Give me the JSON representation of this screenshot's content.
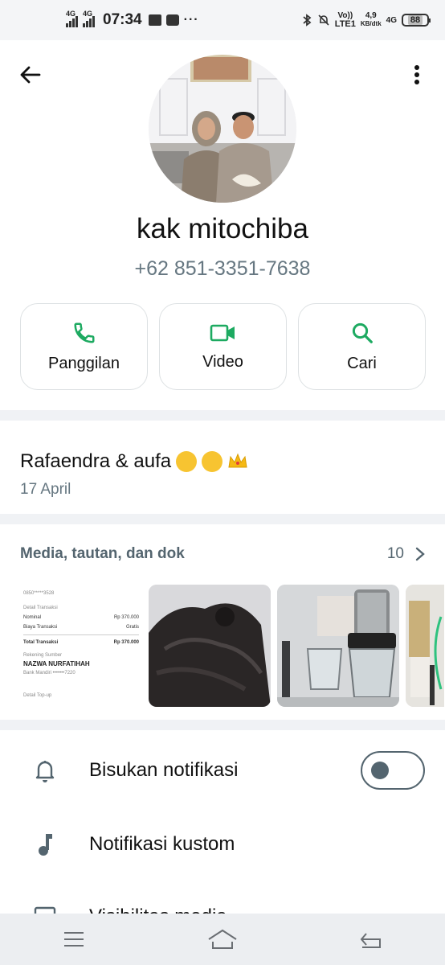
{
  "status_bar": {
    "net1": "4G",
    "net2": "4G",
    "time": "07:34",
    "dots": "···",
    "volte": "Vo))",
    "lte": "LTE1",
    "speed_value": "4,9",
    "speed_unit": "KB/dtk",
    "net3": "4G",
    "battery": "88"
  },
  "contact": {
    "name": "kak mitochiba",
    "phone": "+62 851-3351-7638"
  },
  "actions": [
    {
      "label": "Panggilan",
      "icon": "phone-icon"
    },
    {
      "label": "Video",
      "icon": "video-icon"
    },
    {
      "label": "Cari",
      "icon": "search-icon"
    }
  ],
  "about": {
    "text": "Rafaendra & aufa",
    "date": "17 April"
  },
  "media": {
    "title": "Media, tautan, dan dok",
    "count": "10",
    "receipt": {
      "number": "0850*****3528",
      "section": "Detail Transaksi",
      "nominal_label": "Nominal",
      "nominal_value": "Rp 370.000",
      "fee_label": "Biaya Transaksi",
      "fee_value": "Gratis",
      "total_label": "Total Transaksi",
      "total_value": "Rp 370.000",
      "source_label": "Rekening Sumber",
      "source_name": "NAZWA NURFATIHAH",
      "bank": "Bank Mandiri •••••••7220",
      "footer": "Detail Top-up"
    }
  },
  "settings": [
    {
      "label": "Bisukan notifikasi",
      "icon": "bell-icon"
    },
    {
      "label": "Notifikasi kustom",
      "icon": "music-note-icon"
    },
    {
      "label": "Visibilitas media",
      "icon": "image-icon"
    }
  ],
  "colors": {
    "accent": "#1daa61",
    "muted": "#667781",
    "divider": "#f0f2f5"
  }
}
